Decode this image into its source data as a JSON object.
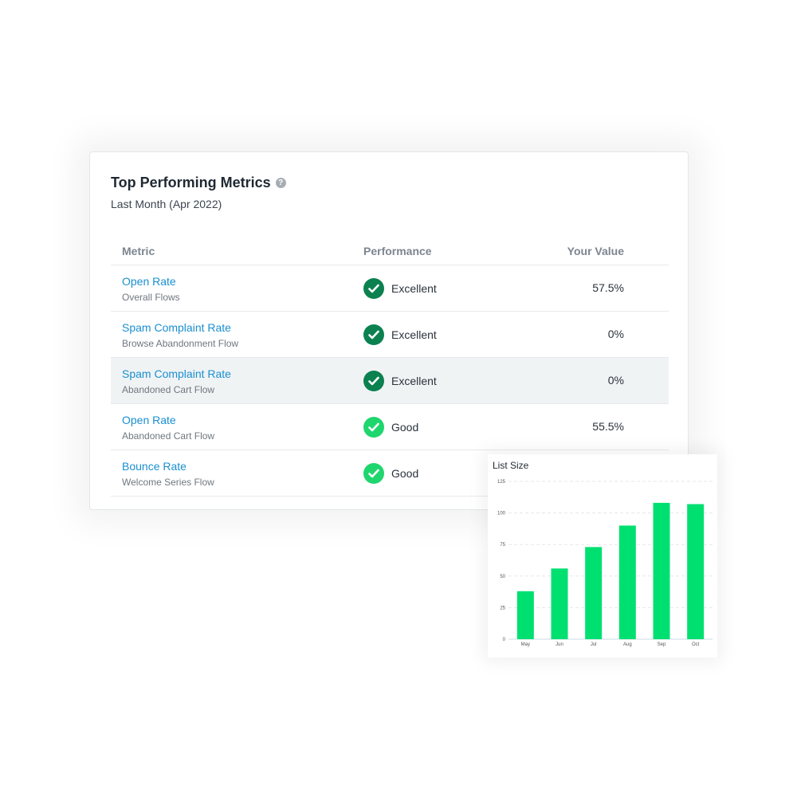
{
  "card": {
    "title": "Top Performing Metrics",
    "help_icon": "question-circle-icon",
    "subtitle": "Last Month (Apr 2022)",
    "columns": [
      "Metric",
      "Performance",
      "Your Value"
    ],
    "rows": [
      {
        "metric": "Open Rate",
        "flow": "Overall Flows",
        "performance": "Excellent",
        "value": "57.5%",
        "highlighted": false
      },
      {
        "metric": "Spam Complaint Rate",
        "flow": "Browse Abandonment Flow",
        "performance": "Excellent",
        "value": "0%",
        "highlighted": false
      },
      {
        "metric": "Spam Complaint Rate",
        "flow": "Abandoned Cart Flow",
        "performance": "Excellent",
        "value": "0%",
        "highlighted": true
      },
      {
        "metric": "Open Rate",
        "flow": "Abandoned Cart Flow",
        "performance": "Good",
        "value": "55.5%",
        "highlighted": false
      },
      {
        "metric": "Bounce Rate",
        "flow": "Welcome Series Flow",
        "performance": "Good",
        "value": "",
        "highlighted": false
      }
    ],
    "colors": {
      "Excellent": "#0b8150",
      "Good": "#1fd66e",
      "link": "#1a8fd0"
    }
  },
  "chart_data": {
    "type": "bar",
    "title": "List Size",
    "categories": [
      "May",
      "Jun",
      "Jul",
      "Aug",
      "Sep",
      "Oct"
    ],
    "values": [
      38,
      56,
      73,
      90,
      108,
      107
    ],
    "ylim": [
      0,
      125
    ],
    "yticks": [
      0,
      25,
      50,
      75,
      100,
      125
    ],
    "grid": true,
    "bar_color": "#00e070"
  }
}
